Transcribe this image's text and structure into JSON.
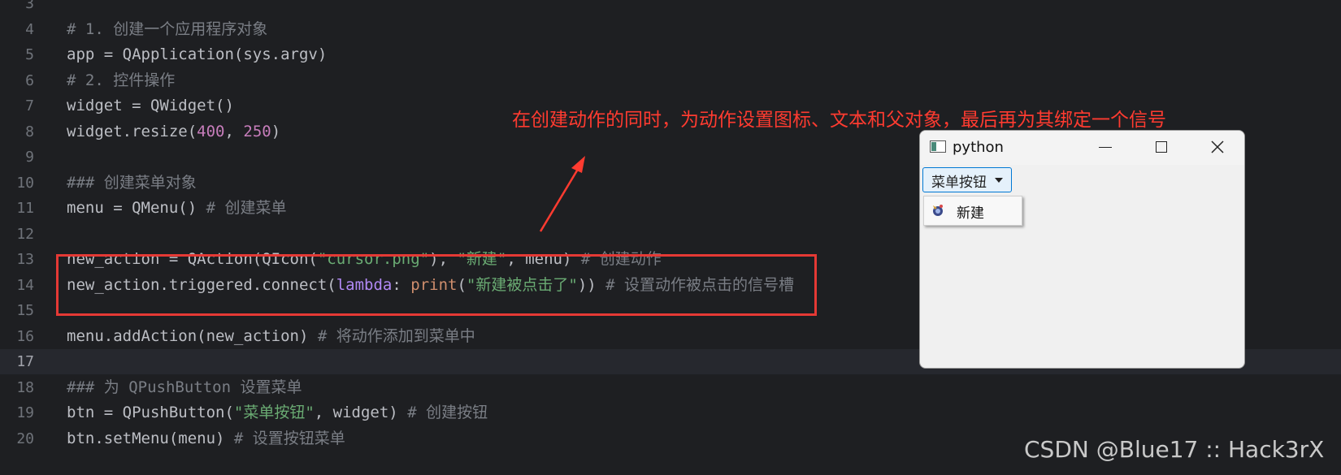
{
  "code_lines": [
    {
      "num": "3",
      "tokens": []
    },
    {
      "num": "4",
      "tokens": [
        {
          "t": "# 1. 创建一个应用程序对象",
          "c": "c"
        }
      ]
    },
    {
      "num": "5",
      "tokens": [
        {
          "t": "app = QApplication(sys.argv)",
          "c": ""
        }
      ]
    },
    {
      "num": "6",
      "tokens": [
        {
          "t": "# 2. 控件操作",
          "c": "c"
        }
      ]
    },
    {
      "num": "7",
      "tokens": [
        {
          "t": "widget = QWidget()",
          "c": ""
        }
      ]
    },
    {
      "num": "8",
      "tokens": [
        {
          "t": "widget.resize(",
          "c": ""
        },
        {
          "t": "400",
          "c": "num"
        },
        {
          "t": ", ",
          "c": ""
        },
        {
          "t": "250",
          "c": "num"
        },
        {
          "t": ")",
          "c": ""
        }
      ]
    },
    {
      "num": "9",
      "tokens": []
    },
    {
      "num": "10",
      "tokens": [
        {
          "t": "### 创建菜单对象",
          "c": "c"
        }
      ]
    },
    {
      "num": "11",
      "tokens": [
        {
          "t": "menu = QMenu() ",
          "c": ""
        },
        {
          "t": "# 创建菜单",
          "c": "c"
        }
      ]
    },
    {
      "num": "12",
      "tokens": []
    },
    {
      "num": "13",
      "tokens": [
        {
          "t": "new_action = QAction(QIcon(",
          "c": ""
        },
        {
          "t": "\"cursor.png\"",
          "c": "s"
        },
        {
          "t": "), ",
          "c": ""
        },
        {
          "t": "\"新建\"",
          "c": "s"
        },
        {
          "t": ", menu) ",
          "c": ""
        },
        {
          "t": "# 创建动作",
          "c": "c"
        }
      ]
    },
    {
      "num": "14",
      "tokens": [
        {
          "t": "new_action.triggered.connect(",
          "c": ""
        },
        {
          "t": "lambda",
          "c": "lam"
        },
        {
          "t": ": ",
          "c": ""
        },
        {
          "t": "print",
          "c": "kw"
        },
        {
          "t": "(",
          "c": ""
        },
        {
          "t": "\"新建被点击了\"",
          "c": "s"
        },
        {
          "t": ")) ",
          "c": ""
        },
        {
          "t": "# 设置动作被点击的信号槽",
          "c": "c"
        }
      ]
    },
    {
      "num": "15",
      "tokens": []
    },
    {
      "num": "16",
      "tokens": [
        {
          "t": "menu.addAction(new_action) ",
          "c": ""
        },
        {
          "t": "# 将动作添加到菜单中",
          "c": "c"
        }
      ]
    },
    {
      "num": "17",
      "tokens": [],
      "current": true
    },
    {
      "num": "18",
      "tokens": [
        {
          "t": "### 为 QPushButton 设置菜单",
          "c": "c"
        }
      ]
    },
    {
      "num": "19",
      "tokens": [
        {
          "t": "btn = QPushButton(",
          "c": ""
        },
        {
          "t": "\"菜单按钮\"",
          "c": "s"
        },
        {
          "t": ", widget) ",
          "c": ""
        },
        {
          "t": "# 创建按钮",
          "c": "c"
        }
      ]
    },
    {
      "num": "20",
      "tokens": [
        {
          "t": "btn.setMenu(menu) ",
          "c": ""
        },
        {
          "t": "# 设置按钮菜单",
          "c": "c"
        }
      ]
    }
  ],
  "annotation": {
    "text": "在创建动作的同时，为动作设置图标、文本和父对象，最后再为其绑定一个信号"
  },
  "window": {
    "title": "python",
    "menu_button_label": "菜单按钮",
    "menu_items": [
      {
        "label": "新建",
        "icon": "cursor-icon"
      }
    ]
  },
  "watermark": "CSDN @Blue17 :: Hack3rX",
  "colors": {
    "editor_bg": "#1e1f22",
    "annotation": "#ff3b30",
    "highlight_box": "#e53935",
    "string": "#6aab73",
    "comment": "#7a7e85",
    "number": "#c77dbb",
    "keyword": "#cf8e6d",
    "lambda": "#b189f5"
  }
}
